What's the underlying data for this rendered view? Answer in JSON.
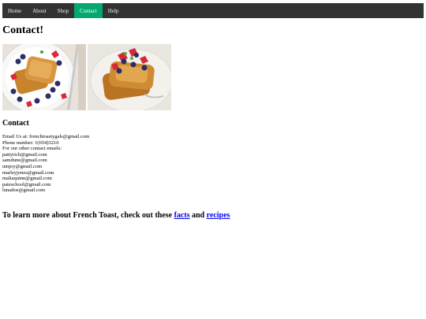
{
  "nav": {
    "items": [
      {
        "label": "Home",
        "active": false
      },
      {
        "label": "About",
        "active": false
      },
      {
        "label": "Shop",
        "active": false
      },
      {
        "label": "Contact",
        "active": true
      },
      {
        "label": "Help",
        "active": false
      }
    ]
  },
  "page": {
    "title": "Contact!"
  },
  "contact": {
    "heading": "Contact",
    "email_line": "Email Us at: frenchtoastygals@gmail.com",
    "phone_line": "Phone number: 1(654)3210",
    "other_label": "For our other contact emails:",
    "emails": [
      "pattyrich@gmail.com",
      "samdune@gmail.com",
      "umjoy@gmail.com",
      "marleyjones@gmail.com",
      "maliaquinn@gmail.com",
      "pateschool@gmail.com",
      "lunadoe@gmail.com"
    ]
  },
  "learn_more": {
    "prefix": "To learn more about French Toast, check out these ",
    "facts_link": "facts",
    "middle": " and ",
    "recipes_link": "recipes"
  },
  "colors": {
    "nav_bg": "#333333",
    "nav_active": "#04aa6d",
    "link": "#0000ee"
  }
}
